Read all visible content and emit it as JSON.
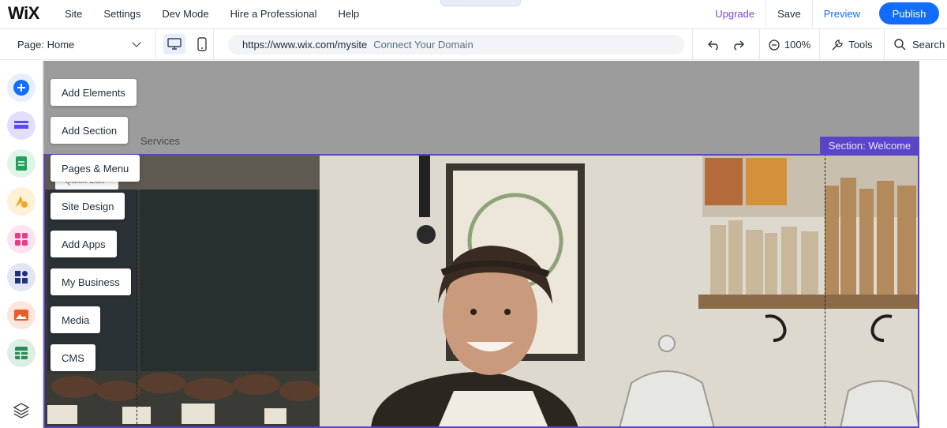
{
  "top_bar": {
    "logo": "WiX",
    "menu": [
      "Site",
      "Settings",
      "Dev Mode",
      "Hire a Professional",
      "Help"
    ],
    "upgrade": "Upgrade",
    "save": "Save",
    "preview": "Preview",
    "publish": "Publish"
  },
  "second_bar": {
    "page_select": "Page: Home",
    "url": "https://www.wix.com/mysite",
    "connect_domain": "Connect Your Domain",
    "zoom": "100%",
    "tools": "Tools",
    "search": "Search"
  },
  "left_rail": {
    "icons": [
      "add-elements-icon",
      "add-section-icon",
      "pages-menu-icon",
      "site-design-icon",
      "add-apps-icon",
      "my-business-icon",
      "media-icon",
      "cms-icon"
    ],
    "colors": [
      "#116dff",
      "#5a48f5",
      "#25a05a",
      "#f5a623",
      "#e53d8b",
      "#22307a",
      "#f05a24",
      "#2e8b57"
    ]
  },
  "add_panel": {
    "buttons": [
      "Add Elements",
      "Add Section",
      "Pages & Menu",
      "Site Design",
      "Add Apps",
      "My Business",
      "Media",
      "CMS"
    ]
  },
  "canvas": {
    "nav_item": "Services",
    "section_label": "Section: Welcome",
    "ghost_text": "Quick Edit"
  }
}
